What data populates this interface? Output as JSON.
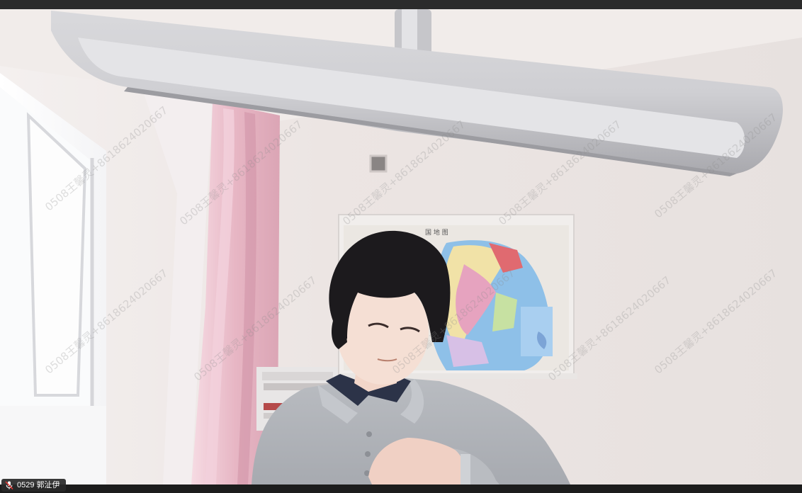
{
  "participant": {
    "label": "0529 郭沚伊"
  },
  "watermark_text": "0508王馨灵+8618624020667",
  "icons": {
    "mic": "mic-muted-icon"
  },
  "colors": {
    "frame": "#222222",
    "name_tag_bg": "#282828",
    "mic_red": "#e53935"
  }
}
